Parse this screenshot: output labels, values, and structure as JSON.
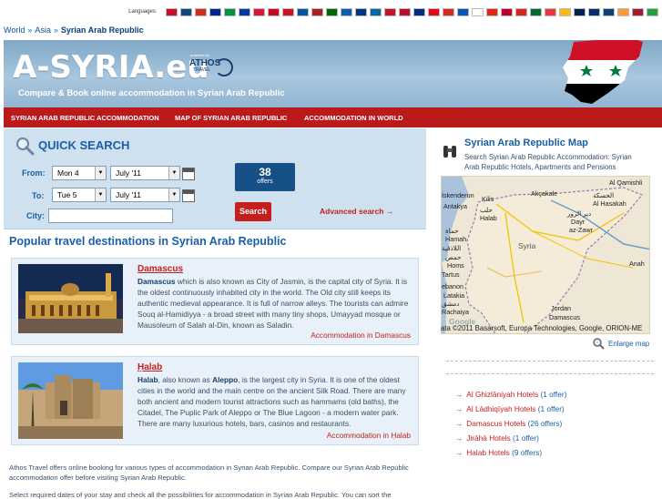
{
  "langbar": {
    "label": "Languages:",
    "flags": [
      "#c8102e",
      "#11457e",
      "#d52b1e",
      "#002395",
      "#009246",
      "#0039a6",
      "#dc143c",
      "#c60b1e",
      "#ce1126",
      "#0055a4",
      "#ae1c28",
      "#006600",
      "#0d5eaf",
      "#003580",
      "#006aa7",
      "#c8102e",
      "#ba0c2f",
      "#002b7f",
      "#e30a17",
      "#d52b1e",
      "#0057b7",
      "#ffffff",
      "#de2910",
      "#bc002d",
      "#da251d",
      "#006c35",
      "#ef3340",
      "#fdb913",
      "#00205b",
      "#002f6c",
      "#0c4076",
      "#ff9933",
      "#a51931",
      "#239f40"
    ]
  },
  "breadcrumb": {
    "world": "World",
    "sep": "»",
    "asia": "Asia",
    "current": "Syrian Arab Republic"
  },
  "header": {
    "logo": "A-SYRIA.eu",
    "powered": "powered by",
    "athos": "ATHOS",
    "athos_sub": "TRAVEL",
    "tagline": "Compare & Book online accommodation in Syrian Arab Republic"
  },
  "nav": {
    "item1": "SYRIAN ARAB REPUBLIC ACCOMMODATION",
    "item2": "MAP OF SYRIAN ARAB REPUBLIC",
    "item3": "ACCOMMODATION IN WORLD"
  },
  "quick_search": {
    "title": "QUICK SEARCH",
    "from_label": "From:",
    "to_label": "To:",
    "city_label": "City:",
    "from_day": "Mon 4",
    "from_month": "July '11",
    "to_day": "Tue 5",
    "to_month": "July '11",
    "offers_count": "38",
    "offers_label": "offers",
    "search_button": "Search",
    "advanced": "Advanced search →"
  },
  "popular": {
    "title": "Popular travel destinations in Syrian Arab Republic",
    "items": [
      {
        "name": "Damascus",
        "bold": "Damascus",
        "text": " which is also known as City of Jasmin, is the capital city of Syria. It is the oldest continuously inhabited city in the world. The Old city still keeps its authentic medieval appearance. It is full of narrow alleys. The tourists can admire Souq al-Hamidiyya - a broad street with many tiny shops, Umayyad mosque or Mausoleum of Salah al-Din, known as Saladin.",
        "link": "Accommodation in Damascus"
      },
      {
        "name": "Ḥalab",
        "bold": "Halab",
        "text_pre": ", also known as ",
        "bold2": "Aleppo",
        "text": ", is the largest city in Syria. It is one of the oldest cities in the world and the main centre on the ancient Silk Road. There are many both ancient and modern tourist attractions such as hammams (old baths), the Citadel, The Puplic Park of Aleppo or The Blue Lagoon - a modern water park. There are many luxurious hotels, bars, casinos and restaurants.",
        "link": "Accommodation in Ḥalab"
      }
    ]
  },
  "footnote": "Athos Travel offers online booking for various types of accommodation in Syrian Arab Republic. Compare our Syrian Arab Republic accommodation offer before visiting Syrian Arab Republic.",
  "footnote2": "Select required dates of your stay and check all the possibilities for accommodation in Syrian Arab Republic. You can sort the",
  "right": {
    "title": "Syrian Arab Republic Map",
    "subtitle": "Search Syrian Arab Republic Accommodation: Syrian Arab Republic Hotels, Apartments and Pensions",
    "map_labels": {
      "kilis": "Kilis",
      "akcakale": "Akçakale",
      "al_qamishli": "Al Qamishli",
      "iskenderun": "İskenderun",
      "al_hasakah_ar": "الحسكة",
      "al_hasakah": "Al Hasakah",
      "antakya": "Antakya",
      "halab_ar": "حلب",
      "halab": "Halab",
      "dayr_ar": "دير الزور",
      "dayr": "Dayr",
      "az_zawr": "az-Zawr",
      "hamah_ar": "حماة",
      "hamah": "Hamah",
      "latakia_ar": "اللاذقية",
      "latakia": "Latakia",
      "syria": "Syria",
      "homs_ar": "حمص",
      "homs": "Homs",
      "anah": "Anah",
      "tartus": "Tartus",
      "lebanon": "ebanon",
      "damascus_ar": "دمشق",
      "damascus": "Damascus",
      "rachaiya": "Rachaiya",
      "jordan": "Jordan",
      "google": "Google"
    },
    "credit": "ata ©2011 Basarsoft, Europa Technologies, Google, ORION-ME",
    "enlarge": "Enlarge map",
    "hotels": [
      {
        "name": "Al Ghizlāniyah Hotels",
        "count": "(1 offer)"
      },
      {
        "name": "Al Lādhiqīyah Hotels",
        "count": "(1 offer)"
      },
      {
        "name": "Damascus Hotels",
        "count": "(26 offers)"
      },
      {
        "name": "Jirāhā Hotels",
        "count": "(1 offer)"
      },
      {
        "name": "Ḥalab Hotels",
        "count": "(9 offers)"
      }
    ]
  }
}
